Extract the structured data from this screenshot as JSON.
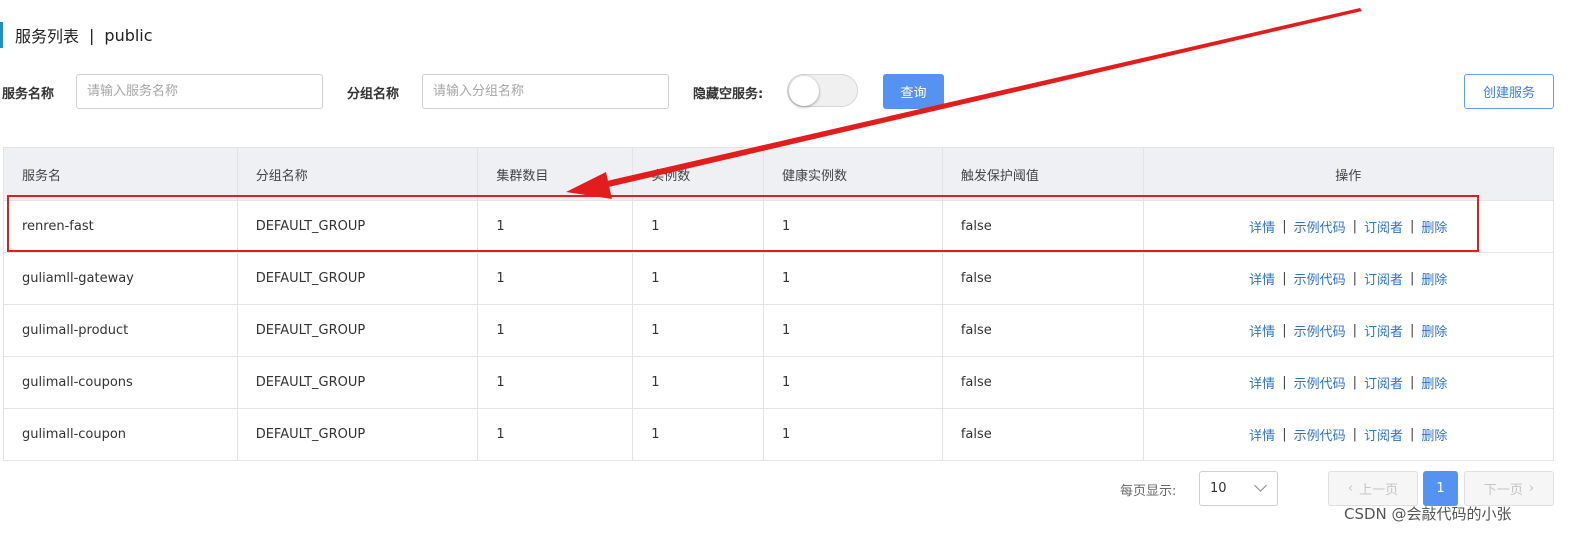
{
  "header": {
    "title": "服务列表",
    "separator": "|",
    "namespace": "public"
  },
  "filters": {
    "service_name_label": "服务名称",
    "service_name_placeholder": "请输入服务名称",
    "group_name_label": "分组名称",
    "group_name_placeholder": "请输入分组名称",
    "hide_empty_label": "隐藏空服务:",
    "hide_empty_on": false,
    "query_button": "查询",
    "create_button": "创建服务"
  },
  "table": {
    "columns": [
      "服务名",
      "分组名称",
      "集群数目",
      "实例数",
      "健康实例数",
      "触发保护阈值",
      "操作"
    ],
    "rows": [
      {
        "name": "renren-fast",
        "group": "DEFAULT_GROUP",
        "clusters": "1",
        "instances": "1",
        "healthy": "1",
        "protect": "false"
      },
      {
        "name": "guliamll-gateway",
        "group": "DEFAULT_GROUP",
        "clusters": "1",
        "instances": "1",
        "healthy": "1",
        "protect": "false"
      },
      {
        "name": "gulimall-product",
        "group": "DEFAULT_GROUP",
        "clusters": "1",
        "instances": "1",
        "healthy": "1",
        "protect": "false"
      },
      {
        "name": "gulimall-coupons",
        "group": "DEFAULT_GROUP",
        "clusters": "1",
        "instances": "1",
        "healthy": "1",
        "protect": "false"
      },
      {
        "name": "gulimall-coupon",
        "group": "DEFAULT_GROUP",
        "clusters": "1",
        "instances": "1",
        "healthy": "1",
        "protect": "false"
      }
    ],
    "actions": {
      "detail": "详情",
      "sample_code": "示例代码",
      "subscribers": "订阅者",
      "delete": "删除",
      "separator": "|"
    }
  },
  "pagination": {
    "page_size_label": "每页显示:",
    "page_size": "10",
    "prev": "上一页",
    "next": "下一页",
    "current_page": "1"
  },
  "annotation": {
    "highlight_color": "#e21d1d"
  },
  "watermark": "CSDN @会敲代码的小张",
  "colors": {
    "primary": "#5692f2",
    "link": "#2f73c7",
    "accent_bar": "#1e90c8"
  }
}
